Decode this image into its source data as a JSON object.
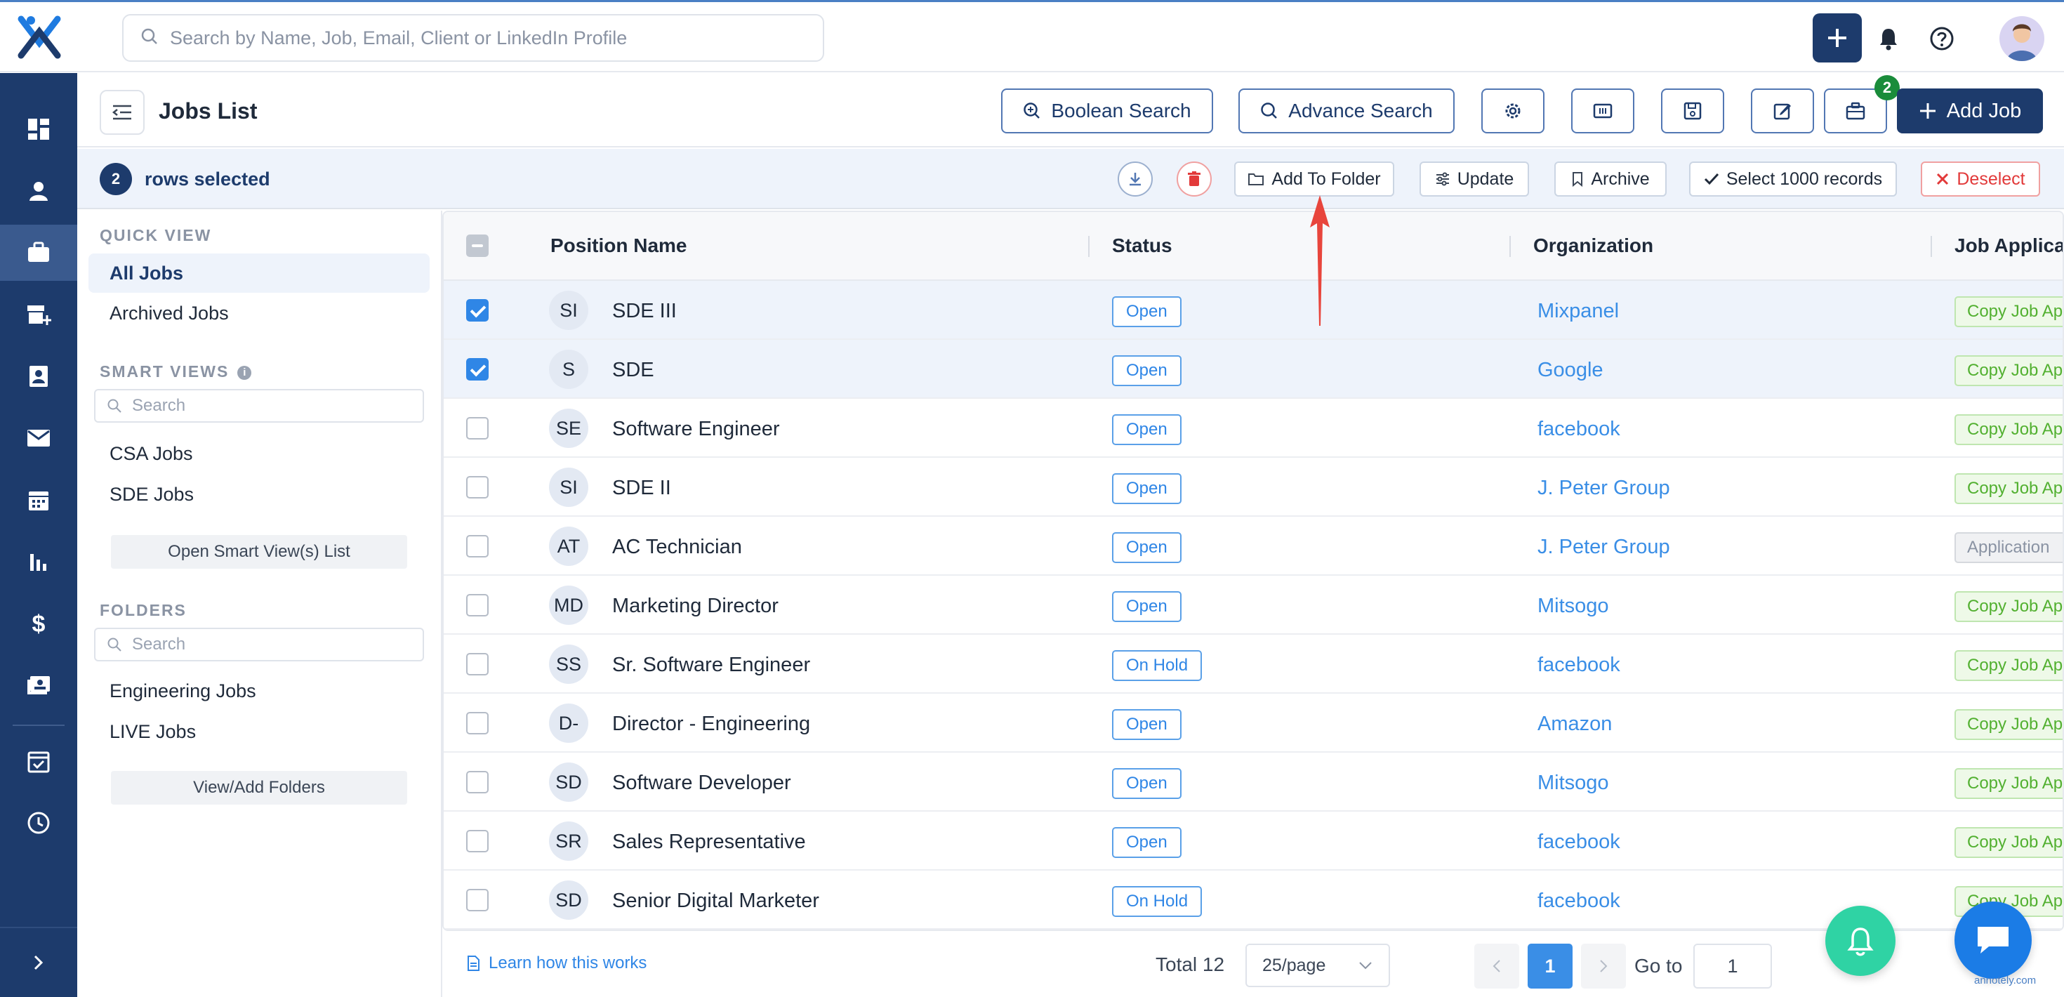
{
  "search": {
    "placeholder": "Search by Name, Job, Email, Client or LinkedIn Profile"
  },
  "header": {
    "title": "Jobs List",
    "boolean_search": "Boolean Search",
    "advance_search": "Advance Search",
    "add_job": "Add Job",
    "badge_count": "2"
  },
  "selection": {
    "count": "2",
    "label": "rows selected",
    "add_to_folder": "Add To Folder",
    "update": "Update",
    "archive": "Archive",
    "select_all": "Select 1000 records",
    "deselect": "Deselect"
  },
  "sidebar": {
    "quick_view_title": "QUICK VIEW",
    "quick_views": [
      "All Jobs",
      "Archived Jobs"
    ],
    "smart_views_title": "SMART VIEWS",
    "smart_search_placeholder": "Search",
    "smart_views": [
      "CSA Jobs",
      "SDE Jobs"
    ],
    "open_smart_views": "Open Smart View(s) List",
    "folders_title": "FOLDERS",
    "folder_search_placeholder": "Search",
    "folders": [
      "Engineering Jobs",
      "LIVE Jobs"
    ],
    "view_add_folders": "View/Add Folders"
  },
  "table": {
    "columns": [
      "Position Name",
      "Status",
      "Organization",
      "Job Applica"
    ],
    "rows": [
      {
        "initials": "SI",
        "position": "SDE III",
        "status": "Open",
        "organization": "Mixpanel",
        "application": "Copy Job Ap",
        "app_style": "green",
        "checked": true
      },
      {
        "initials": "S",
        "position": "SDE",
        "status": "Open",
        "organization": "Google",
        "application": "Copy Job Ap",
        "app_style": "green",
        "checked": true
      },
      {
        "initials": "SE",
        "position": "Software Engineer",
        "status": "Open",
        "organization": "facebook",
        "application": "Copy Job Ap",
        "app_style": "green",
        "checked": false
      },
      {
        "initials": "SI",
        "position": "SDE II",
        "status": "Open",
        "organization": "J. Peter Group",
        "application": "Copy Job Ap",
        "app_style": "green",
        "checked": false
      },
      {
        "initials": "AT",
        "position": "AC Technician",
        "status": "Open",
        "organization": "J. Peter Group",
        "application": "Application",
        "app_style": "gray",
        "checked": false
      },
      {
        "initials": "MD",
        "position": "Marketing Director",
        "status": "Open",
        "organization": "Mitsogo",
        "application": "Copy Job Ap",
        "app_style": "green",
        "checked": false
      },
      {
        "initials": "SS",
        "position": "Sr. Software Engineer",
        "status": "On Hold",
        "organization": "facebook",
        "application": "Copy Job Ap",
        "app_style": "green",
        "checked": false
      },
      {
        "initials": "D-",
        "position": "Director - Engineering",
        "status": "Open",
        "organization": "Amazon",
        "application": "Copy Job Ap",
        "app_style": "green",
        "checked": false
      },
      {
        "initials": "SD",
        "position": "Software Developer",
        "status": "Open",
        "organization": "Mitsogo",
        "application": "Copy Job Ap",
        "app_style": "green",
        "checked": false
      },
      {
        "initials": "SR",
        "position": "Sales Representative",
        "status": "Open",
        "organization": "facebook",
        "application": "Copy Job Ap",
        "app_style": "green",
        "checked": false
      },
      {
        "initials": "SD",
        "position": "Senior Digital Marketer",
        "status": "On Hold",
        "organization": "facebook",
        "application": "Copy Job Ap",
        "app_style": "green",
        "checked": false
      }
    ]
  },
  "footer": {
    "learn": "Learn how this works",
    "total": "Total 12",
    "page_size": "25/page",
    "current_page": "1",
    "goto_label": "Go to",
    "goto_value": "1"
  },
  "watermark": "annotely.com",
  "colors": {
    "brand": "#1d3b6c",
    "accent": "#2f86e6",
    "danger": "#e23a3a",
    "success": "#52b030"
  }
}
